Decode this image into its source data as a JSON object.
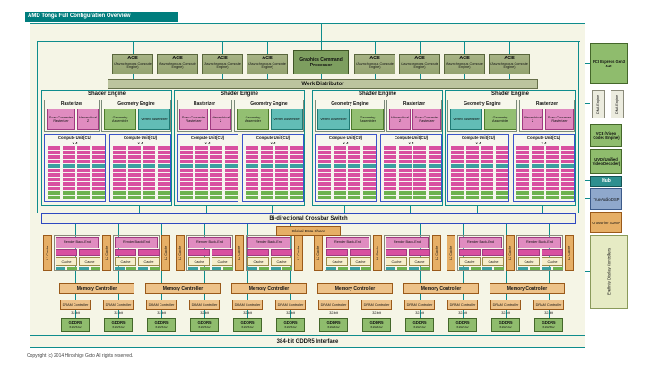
{
  "title": "AMD Tonga Full Configuration Overview",
  "copyright": "Copyright (c) 2014 Hiroshige Goto All rights reserved.",
  "top": {
    "ace_label": "ACE",
    "ace_sub": "(Asynchronous Compute Engine)",
    "ace_count": 8,
    "gcp_label": "Graphics Command Processor",
    "work_distributor": "Work Distributor"
  },
  "shader_engines": [
    {
      "label": "Shader Engine",
      "flip": false
    },
    {
      "label": "Shader Engine",
      "flip": false
    },
    {
      "label": "Shader Engine",
      "flip": true
    },
    {
      "label": "Shader Engine",
      "flip": true
    }
  ],
  "shader_engine_parts": {
    "rasterizer": "Rasterizer",
    "geometry_engine": "Geometry Engine",
    "scan_converter": "Scan Converter Rasterizer",
    "hierarchical_z": "Hierarchical Z",
    "geometry_assembler": "Geometry Assembler",
    "vertex_assembler": "Vertex Assembler",
    "cu_label": "Compute Unit(CU)",
    "cu_sub": "x 4",
    "cu_groups_per_engine": 2
  },
  "crossbar": "Bi-directional Crossbar Switch",
  "global_data_share": "Global Data Share",
  "memory": {
    "l2_label": "L2 Cache",
    "l2_count": 12,
    "rbe_label": "Render Back-End",
    "rbe_count": 8,
    "cache_label": "Cache",
    "mc_label": "Memory Controller",
    "mc_count": 6,
    "dram_label": "DRAM Controller",
    "dram_width": "32-bit",
    "dram_count": 12,
    "gddr5_label": "GDDR5",
    "gddr5_sub": "x16/x32",
    "gddr5_count": 12,
    "interface_label": "384-bit GDDR5 Interface"
  },
  "right_column": [
    {
      "label": "PCI Express Gen3 x16",
      "type": "green"
    },
    {
      "label": "DMA Engine",
      "type": "small"
    },
    {
      "label": "DMA Engine",
      "type": "small"
    },
    {
      "label": "VCE (Video Codec Engine)",
      "type": "green"
    },
    {
      "label": "UVD (Unified Video Decoder)",
      "type": "green"
    },
    {
      "label": "Hub",
      "type": "hub"
    },
    {
      "label": "TrueAudio DSP",
      "type": "blue"
    },
    {
      "label": "CrossFire XDMA",
      "type": "orange"
    },
    {
      "label": "Eyefinity Display Controllers",
      "type": "tall"
    }
  ],
  "colors": {
    "titlebar": "#007d7d",
    "teal_line": "#0e8c8c",
    "diagram_bg": "#f5f5e6",
    "ace": "#a7b386",
    "gcp": "#7d9e5f",
    "wd": "#bcc49e",
    "pink": "#e08cc0",
    "cell_pink": "#d84fa0",
    "green_block": "#93bf72",
    "teal_block": "#62bdb6",
    "cu_border": "#3a55c8",
    "cell_teal": "#3a9f9f",
    "cell_green": "#6db24f",
    "l2": "#e6af66",
    "cache": "#f6eecb",
    "mc": "#edc289",
    "gddr": "#8fbc6d",
    "blue_block": "#8fa8cc",
    "hub": "#2e8f8f",
    "eyefinity": "#e6ebc4"
  }
}
